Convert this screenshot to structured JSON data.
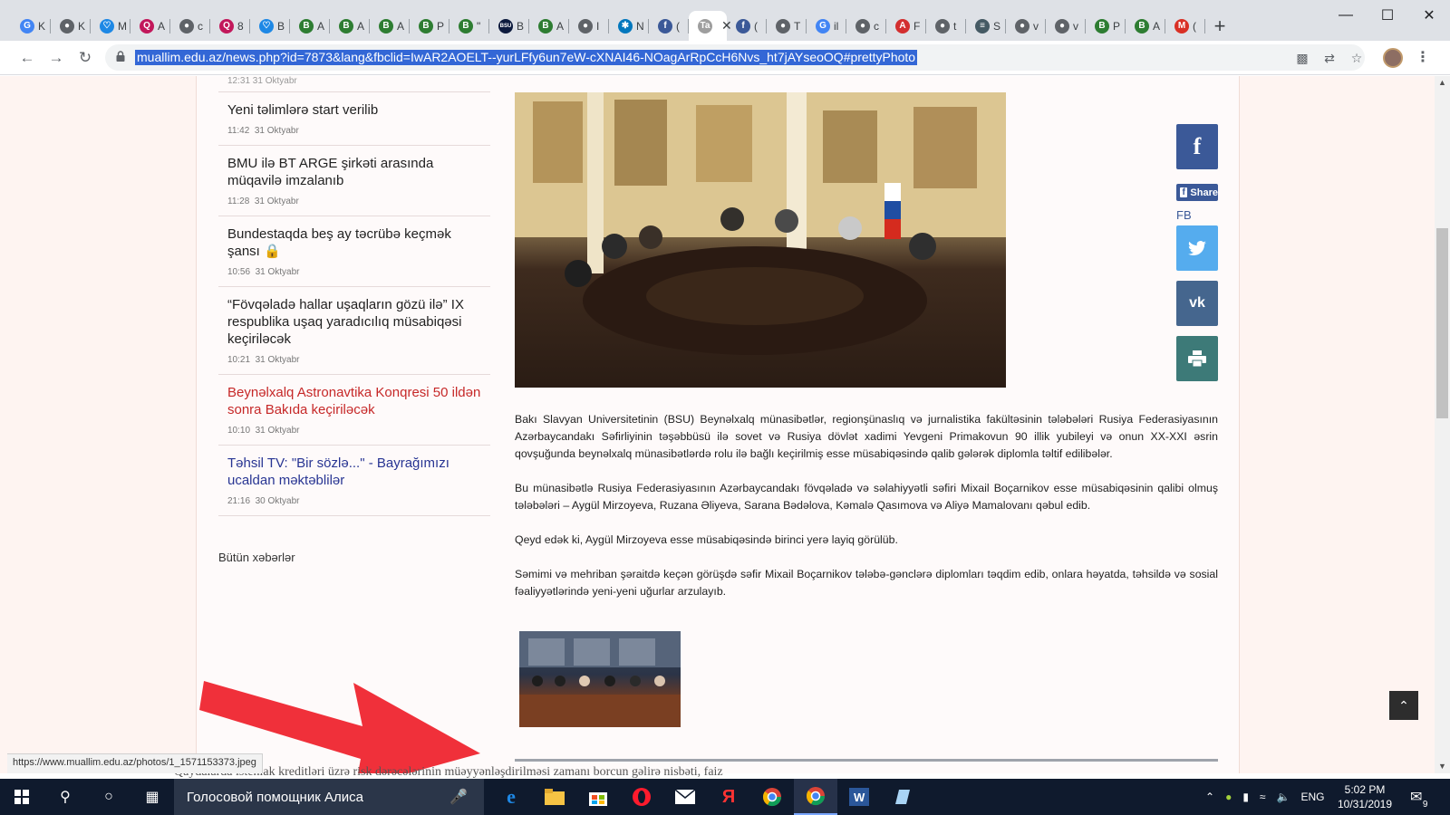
{
  "browser": {
    "tabs": [
      {
        "fav": "G",
        "title": "K",
        "color": "#4285f4"
      },
      {
        "fav": "●",
        "title": "K",
        "color": "#5f6368"
      },
      {
        "fav": "♡",
        "title": "M",
        "color": "#1e88e5"
      },
      {
        "fav": "Q",
        "title": "A",
        "color": "#c2185b"
      },
      {
        "fav": "●",
        "title": "c",
        "color": "#5f6368"
      },
      {
        "fav": "Q",
        "title": "8",
        "color": "#c2185b"
      },
      {
        "fav": "♡",
        "title": "B",
        "color": "#1e88e5"
      },
      {
        "fav": "B",
        "title": "A",
        "color": "#2e7d32"
      },
      {
        "fav": "B",
        "title": "A",
        "color": "#2e7d32"
      },
      {
        "fav": "B",
        "title": "A",
        "color": "#2e7d32"
      },
      {
        "fav": "B",
        "title": "P",
        "color": "#2e7d32"
      },
      {
        "fav": "B",
        "title": "\"",
        "color": "#2e7d32"
      },
      {
        "fav": "BSU",
        "title": "B",
        "color": "#0d1b3e"
      },
      {
        "fav": "B",
        "title": "A",
        "color": "#2e7d32"
      },
      {
        "fav": "●",
        "title": "I",
        "color": "#5f6368"
      },
      {
        "fav": "✱",
        "title": "N",
        "color": "#0277bd"
      },
      {
        "fav": "f",
        "title": "(",
        "color": "#3b5998"
      },
      {
        "fav": "Ta",
        "title": "",
        "color": "#9e9e9e",
        "active": true
      },
      {
        "fav": "f",
        "title": "(",
        "color": "#3b5998"
      },
      {
        "fav": "●",
        "title": "T",
        "color": "#5f6368"
      },
      {
        "fav": "G",
        "title": "il",
        "color": "#4285f4"
      },
      {
        "fav": "●",
        "title": "c",
        "color": "#5f6368"
      },
      {
        "fav": "A",
        "title": "F",
        "color": "#d32f2f"
      },
      {
        "fav": "●",
        "title": "t",
        "color": "#5f6368"
      },
      {
        "fav": "≡",
        "title": "S",
        "color": "#455a64"
      },
      {
        "fav": "●",
        "title": "v",
        "color": "#5f6368"
      },
      {
        "fav": "●",
        "title": "v",
        "color": "#5f6368"
      },
      {
        "fav": "B",
        "title": "P",
        "color": "#2e7d32"
      },
      {
        "fav": "B",
        "title": "A",
        "color": "#2e7d32"
      },
      {
        "fav": "M",
        "title": "(",
        "color": "#d93025"
      }
    ],
    "url": "muallim.edu.az/news.php?id=7873&lang&fbclid=IwAR2AOELT--yurLFfy6un7eW-cXNAI46-NOagArRpCcH6Nvs_ht7jAYseoOQ#prettyPhoto",
    "status_url": "https://www.muallim.edu.az/photos/1_1571153373.jpeg"
  },
  "sidebar": {
    "cut_meta": "12:31  31 Oktyabr",
    "items": [
      {
        "title": "Yeni təlimlərə start verilib",
        "time": "11:42",
        "date": "31 Oktyabr",
        "style": "normal"
      },
      {
        "title": "BMU ilə BT ARGE şirkəti arasında müqavilə imzalanıb",
        "time": "11:28",
        "date": "31 Oktyabr",
        "style": "normal"
      },
      {
        "title": "Bundestaqda beş ay təcrübə keçmək şansı",
        "time": "10:56",
        "date": "31 Oktyabr",
        "style": "normal",
        "lock": true
      },
      {
        "title": "“Fövqəladə hallar uşaqların gözü ilə” IX respublika uşaq yaradıcılıq müsabiqəsi keçiriləcək",
        "time": "10:21",
        "date": "31 Oktyabr",
        "style": "normal"
      },
      {
        "title": "Beynəlxalq Astronavtika Konqresi 50 ildən sonra Bakıda keçiriləcək",
        "time": "10:10",
        "date": "31 Oktyabr",
        "style": "red"
      },
      {
        "title": "Təhsil TV: \"Bir sözlə...\" - Bayrağımızı ucaldan məktəblilər",
        "time": "21:16",
        "date": "30 Oktyabr",
        "style": "blue"
      }
    ],
    "all_news": "Bütün xəbərlər"
  },
  "article": {
    "paragraphs": [
      "Bakı Slavyan Universitetinin (BSU) Beynəlxalq münasibətlər, regionşünaslıq və jurnalistika fakültəsinin tələbələri Rusiya Federasiyasının Azərbaycandakı Səfirliyinin təşəbbüsü ilə sovet və Rusiya dövlət xadimi Yevgeni Primakovun 90 illik yubileyi və onun XX-XXI əsrin qovşuğunda beynəlxalq münasibətlərdə rolu ilə bağlı keçirilmiş esse müsabiqəsində qalib gələrək diplomla təltif edilibələr.",
      "Bu münasibətlə Rusiya Federasiyasının Azərbaycandakı fövqəladə və səlahiyyətli səfiri Mixail Boçarnikov esse müsabiqəsinin qalibi olmuş tələbələri – Aygül Mirzoyeva, Ruzana Əliyeva, Sarana Bədəlova, Kəmalə Qasımova və Aliyə Mamalovanı qəbul edib.",
      "Qeyd edək ki, Aygül Mirzoyeva esse müsabiqəsində birinci yerə layiq görülüb.",
      "Səmimi və mehriban şəraitdə keçən görüşdə səfir Mixail Boçarnikov  tələbə-gənclərə diplomları təqdim edib, onlara həyatda, təhsildə və sosial fəaliyyətlərində yeni-yeni uğurlar arzulayıb."
    ]
  },
  "share": {
    "fb_share_label": "Share",
    "fb_label": "FB",
    "colors": {
      "facebook": "#3b5998",
      "twitter": "#55acee",
      "vk": "#45668e",
      "print": "#3d7a78"
    }
  },
  "page_bottom_text": "Qaydalarda istehlak kreditləri üzrə risk dərəcələrinin müəyyənləşdirilməsi zamanı borcun gəlirə nisbəti, faiz",
  "taskbar": {
    "search_text": "Голосовой помощник Алиса",
    "lang": "ENG",
    "time": "5:02 PM",
    "date": "10/31/2019",
    "notifications": "9"
  }
}
